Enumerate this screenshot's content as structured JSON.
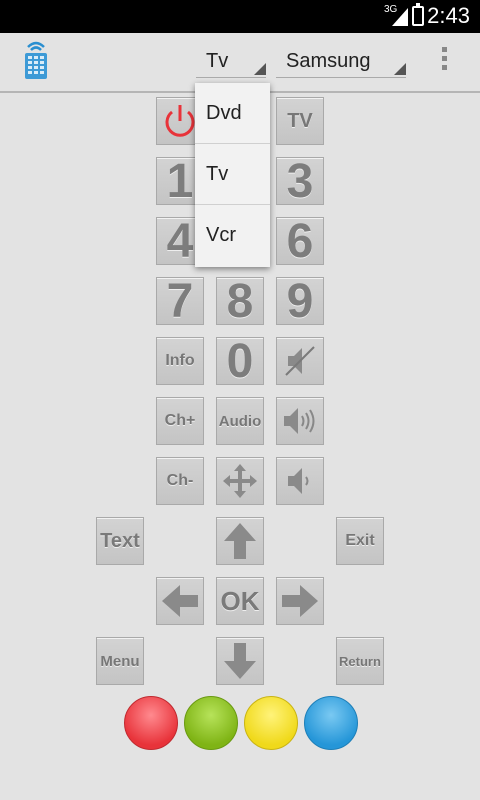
{
  "status_bar": {
    "network": "3G",
    "time": "2:43"
  },
  "action_bar": {
    "app_icon": "remote-icon",
    "device_spinner": {
      "selected": "Tv"
    },
    "brand_spinner": {
      "selected": "Samsung"
    },
    "overflow_icon": "overflow-menu-icon"
  },
  "remote": {
    "power_icon": "power-icon",
    "tv_label": "TV",
    "digits": {
      "one": "1",
      "three": "3",
      "four": "4",
      "six": "6",
      "seven": "7",
      "eight": "8",
      "nine": "9",
      "zero": "0"
    },
    "info_label": "Info",
    "mute_icon": "mute-icon",
    "ch_plus_label": "Ch+",
    "audio_label": "Audio",
    "vol_up_icon": "volume-up-icon",
    "ch_minus_label": "Ch-",
    "move_icon": "move-arrows-icon",
    "vol_down_icon": "volume-down-icon",
    "text_label": "Text",
    "up_icon": "arrow-up-icon",
    "exit_label": "Exit",
    "left_icon": "arrow-left-icon",
    "ok_label": "OK",
    "right_icon": "arrow-right-icon",
    "menu_label": "Menu",
    "down_icon": "arrow-down-icon",
    "return_label": "Return",
    "colors": {
      "red": "#f0525a",
      "green": "#93c727",
      "yellow": "#f4e435",
      "blue": "#3fa9e2"
    }
  },
  "dropdown": {
    "options": [
      "Dvd",
      "Tv",
      "Vcr"
    ]
  },
  "colors": {
    "power_red": "#e8333a",
    "background": "#e3e3e3"
  }
}
